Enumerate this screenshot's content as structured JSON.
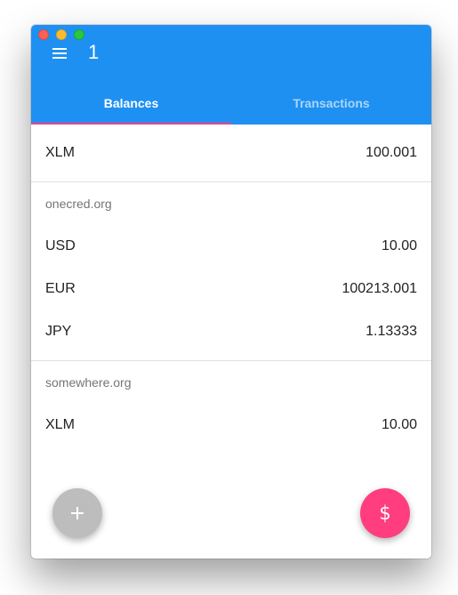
{
  "app": {
    "title": "1"
  },
  "tabs": [
    {
      "label": "Balances",
      "active": true
    },
    {
      "label": "Transactions",
      "active": false
    }
  ],
  "native_balance": {
    "asset": "XLM",
    "amount": "100.001"
  },
  "groups": [
    {
      "issuer": "onecred.org",
      "balances": [
        {
          "asset": "USD",
          "amount": "10.00"
        },
        {
          "asset": "EUR",
          "amount": "100213.001"
        },
        {
          "asset": "JPY",
          "amount": "1.13333"
        }
      ]
    },
    {
      "issuer": "somewhere.org",
      "balances": [
        {
          "asset": "XLM",
          "amount": "10.00"
        }
      ]
    }
  ],
  "fabs": {
    "add_icon": "plus-icon",
    "pay_icon": "dollar-icon",
    "pay_glyph": "$"
  },
  "colors": {
    "appbar": "#1e90f2",
    "tab_indicator": "#ff4081",
    "fab_pay": "#ff3d7f",
    "fab_add": "#bdbdbd"
  }
}
